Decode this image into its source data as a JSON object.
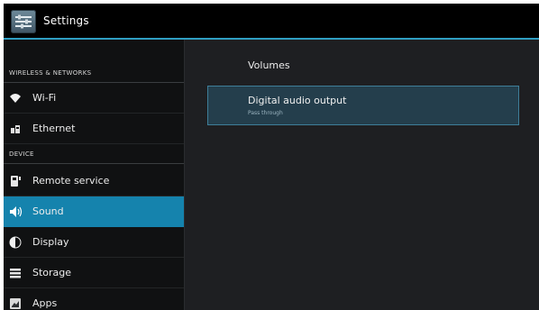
{
  "action_bar": {
    "title": "Settings",
    "icon": "settings-sliders-icon"
  },
  "sidebar": {
    "sections": [
      {
        "header": "WIRELESS & NETWORKS"
      },
      {
        "header": "DEVICE"
      }
    ],
    "items": [
      {
        "label": "Wi-Fi",
        "icon": "wifi-icon"
      },
      {
        "label": "Ethernet",
        "icon": "ethernet-icon"
      },
      {
        "label": "Remote service",
        "icon": "remote-icon"
      },
      {
        "label": "Sound",
        "icon": "speaker-icon",
        "selected": true
      },
      {
        "label": "Display",
        "icon": "display-icon"
      },
      {
        "label": "Storage",
        "icon": "storage-icon"
      },
      {
        "label": "Apps",
        "icon": "apps-icon"
      }
    ]
  },
  "content": {
    "volumes_label": "Volumes",
    "digital_audio": {
      "title": "Digital audio output",
      "summary": "Pass through"
    }
  },
  "colors": {
    "accent": "#1583ad",
    "actionbar_line": "#2f9ec2",
    "panel_bg": "#1e1f22",
    "sidebar_bg": "#101112",
    "highlight_bg": "#243e4c"
  }
}
